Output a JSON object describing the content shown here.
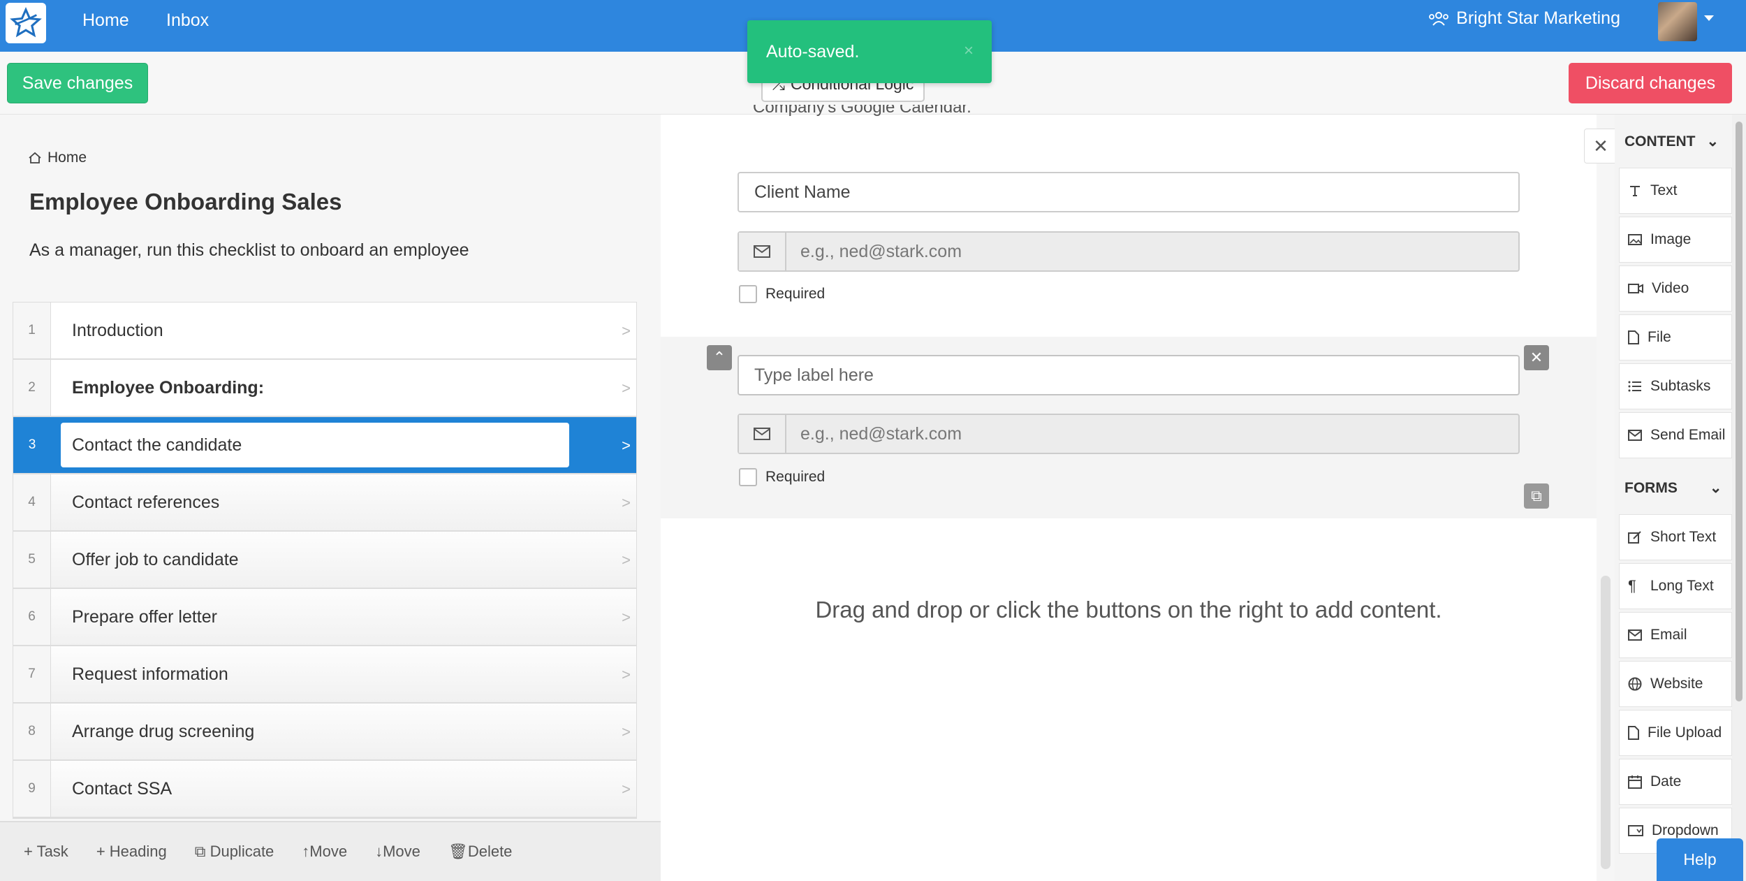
{
  "navbar": {
    "home": "Home",
    "inbox": "Inbox",
    "org": "Bright Star Marketing"
  },
  "toolbar": {
    "save": "Save changes",
    "conditional": "Conditional Logic",
    "discard": "Discard changes"
  },
  "toast": {
    "message": "Auto-saved.",
    "close": "×"
  },
  "checklist": {
    "breadcrumb": "Home",
    "title": "Employee Onboarding Sales",
    "description": "As a manager, run this checklist to onboard an employee",
    "tasks": [
      {
        "num": "1",
        "label": "Introduction"
      },
      {
        "num": "2",
        "label": "Employee Onboarding:"
      },
      {
        "num": "3",
        "label": "Contact the candidate"
      },
      {
        "num": "4",
        "label": "Contact references"
      },
      {
        "num": "5",
        "label": "Offer job to candidate"
      },
      {
        "num": "6",
        "label": "Prepare offer letter"
      },
      {
        "num": "7",
        "label": "Request information"
      },
      {
        "num": "8",
        "label": "Arrange drug screening"
      },
      {
        "num": "9",
        "label": "Contact SSA"
      }
    ]
  },
  "actions": {
    "task": "+ Task",
    "heading": "+ Heading",
    "duplicate": "Duplicate",
    "move_up": "Move",
    "move_down": "Move",
    "delete": "Delete"
  },
  "editor": {
    "cutoff_text": "Company's Google Calendar.",
    "field1": {
      "label_value": "Client Name",
      "email_placeholder": "e.g., ned@stark.com",
      "required": "Required"
    },
    "field2": {
      "label_placeholder": "Type label here",
      "email_placeholder": "e.g., ned@stark.com",
      "required": "Required"
    },
    "hint": "Drag and drop or click the buttons on the right to add content."
  },
  "sidebar": {
    "content_heading": "CONTENT",
    "content_items": [
      "Text",
      "Image",
      "Video",
      "File",
      "Subtasks",
      "Send Email"
    ],
    "forms_heading": "FORMS",
    "forms_items": [
      "Short Text",
      "Long Text",
      "Email",
      "Website",
      "File Upload",
      "Date",
      "Dropdown"
    ]
  },
  "help": "Help",
  "colors": {
    "navbar": "#2e86de",
    "save": "#2ec27e",
    "discard": "#ef4f64",
    "toast": "#23c07d",
    "active_task": "#1f83d6"
  }
}
